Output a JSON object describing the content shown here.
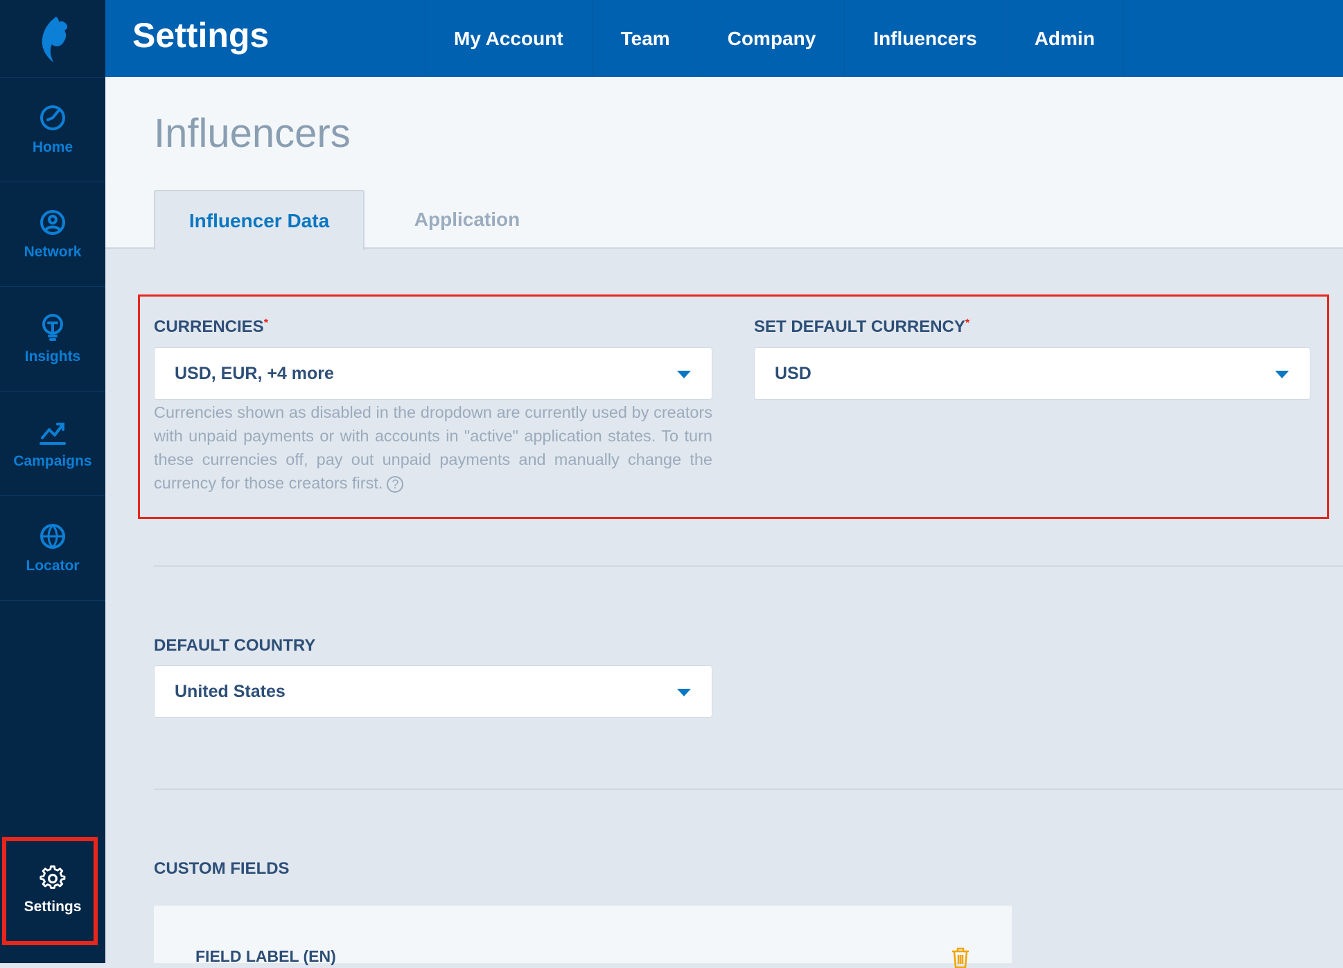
{
  "topbar": {
    "title": "Settings",
    "tabs": [
      "My Account",
      "Team",
      "Company",
      "Influencers",
      "Admin"
    ]
  },
  "sidebar": {
    "items": [
      {
        "label": "Home",
        "icon": "gauge-icon"
      },
      {
        "label": "Network",
        "icon": "user-circle-icon"
      },
      {
        "label": "Insights",
        "icon": "lightbulb-icon"
      },
      {
        "label": "Campaigns",
        "icon": "chart-trend-icon"
      },
      {
        "label": "Locator",
        "icon": "globe-icon"
      },
      {
        "label": "Settings",
        "icon": "gear-icon"
      }
    ]
  },
  "main": {
    "section_title": "Influencers",
    "tabs": {
      "active": "Influencer Data",
      "inactive": "Application"
    },
    "currencies": {
      "label": "CURRENCIES",
      "required_mark": "*",
      "value": "USD, EUR, +4 more",
      "help": "Currencies shown as disabled in the dropdown are currently used by creators with unpaid payments or with accounts in \"active\" application states. To turn these currencies off, pay out unpaid payments and manually change the currency for those creators first."
    },
    "default_currency": {
      "label": "SET DEFAULT CURRENCY",
      "required_mark": "*",
      "value": "USD"
    },
    "default_country": {
      "label": "DEFAULT COUNTRY",
      "value": "United States"
    },
    "custom_fields": {
      "label": "CUSTOM FIELDS",
      "field_label": "FIELD LABEL (EN)"
    }
  },
  "colors": {
    "topbar": "#0061b1",
    "sidebar": "#042748",
    "accent": "#0a77c2",
    "highlight": "#e8261b",
    "trash": "#f0a500"
  }
}
